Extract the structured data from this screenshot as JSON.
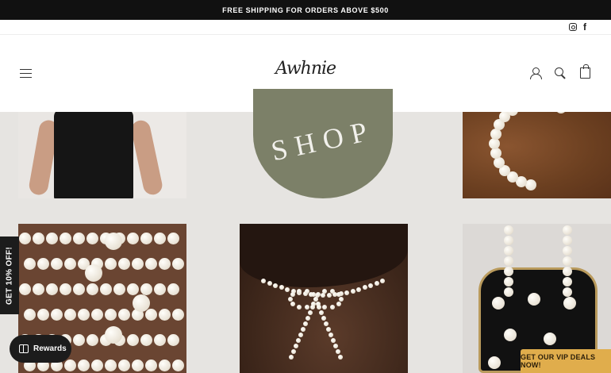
{
  "announcement": {
    "text": "FREE SHIPPING FOR ORDERS ABOVE $500"
  },
  "social": {
    "icons": [
      "instagram-icon",
      "facebook-icon"
    ],
    "facebook_glyph": "f"
  },
  "header": {
    "logo": "Awhnie",
    "icons": [
      "menu-icon",
      "account-icon",
      "search-icon",
      "cart-icon"
    ]
  },
  "grid": {
    "shop_label": "SHOP",
    "tiles": [
      "dress-photo",
      "shop-circle",
      "pearl-hoop-photo",
      "bracelets-photo",
      "pearl-bow-necklace-photo",
      "pearl-bag-photo"
    ]
  },
  "popups": {
    "discount_tab": "GET 10% OFF!",
    "rewards_label": "Rewards",
    "vip_label": "GET OUR VIP DEALS NOW!"
  },
  "colors": {
    "announcement_bg": "#111111",
    "shop_circle": "#7c8068",
    "vip_bg": "#e0ad4c",
    "page_bg": "#e6e4e1"
  }
}
